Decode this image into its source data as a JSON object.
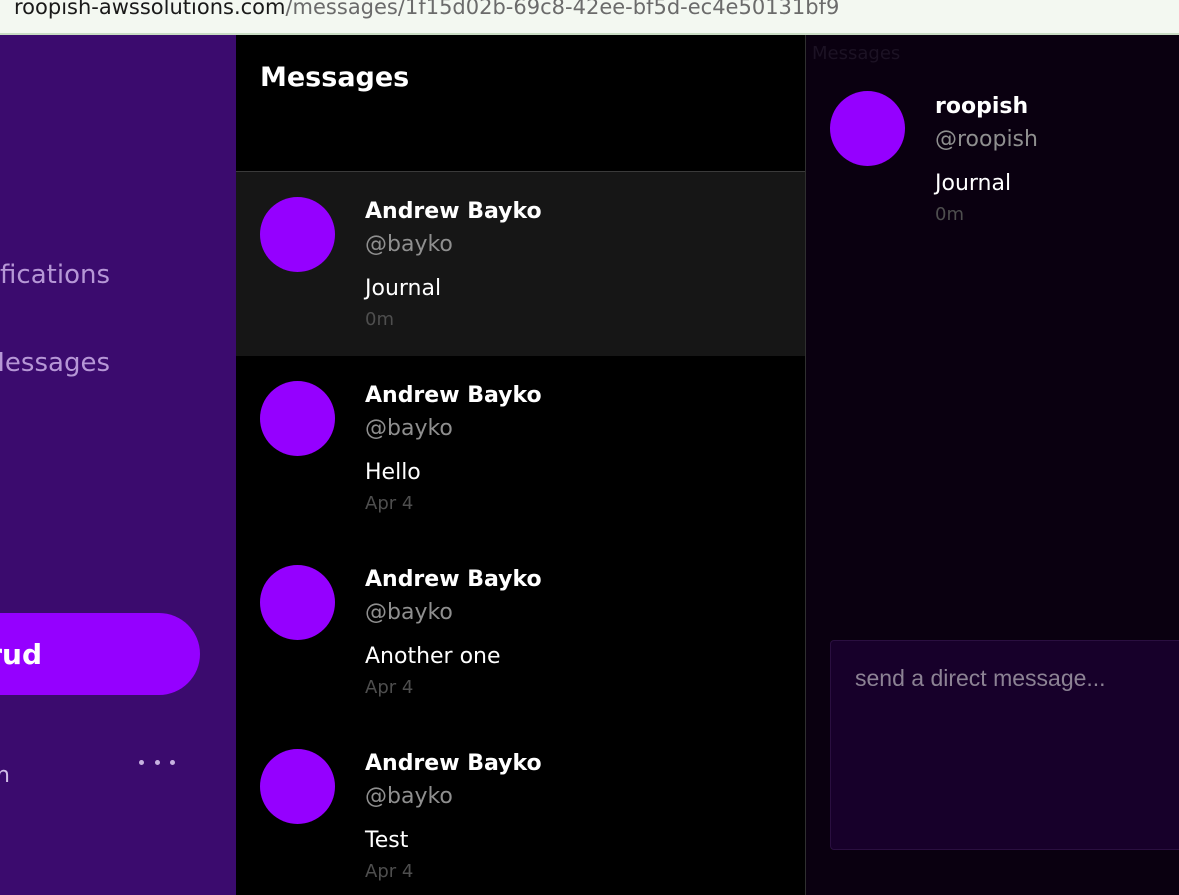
{
  "browser": {
    "url_host": "roopish-awssolutions.com",
    "url_path": "/messages/1f15d02b-69c8-42ee-bf5d-ec4e50131bf9"
  },
  "sidebar": {
    "nav_notifications": "Notifications",
    "nav_messages": "Messages",
    "crud_button": "Crud",
    "account_fragment": "n",
    "more_icon": "more-horizontal-icon"
  },
  "feed": {
    "title": "Messages",
    "items": [
      {
        "name": "Andrew Bayko",
        "handle": "@bayko",
        "text": "Journal",
        "time": "0m"
      },
      {
        "name": "Andrew Bayko",
        "handle": "@bayko",
        "text": "Hello",
        "time": "Apr 4"
      },
      {
        "name": "Andrew Bayko",
        "handle": "@bayko",
        "text": "Another one",
        "time": "Apr 4"
      },
      {
        "name": "Andrew Bayko",
        "handle": "@bayko",
        "text": "Test",
        "time": "Apr 4"
      }
    ]
  },
  "conversation": {
    "label": "Messages",
    "message": {
      "name": "roopish",
      "handle": "@roopish",
      "text": "Journal",
      "time": "0m"
    },
    "input_placeholder": "send a direct message..."
  },
  "colors": {
    "accent": "#9500ff",
    "sidebar_bg": "#3b0b6e",
    "input_bg": "#17002a"
  }
}
